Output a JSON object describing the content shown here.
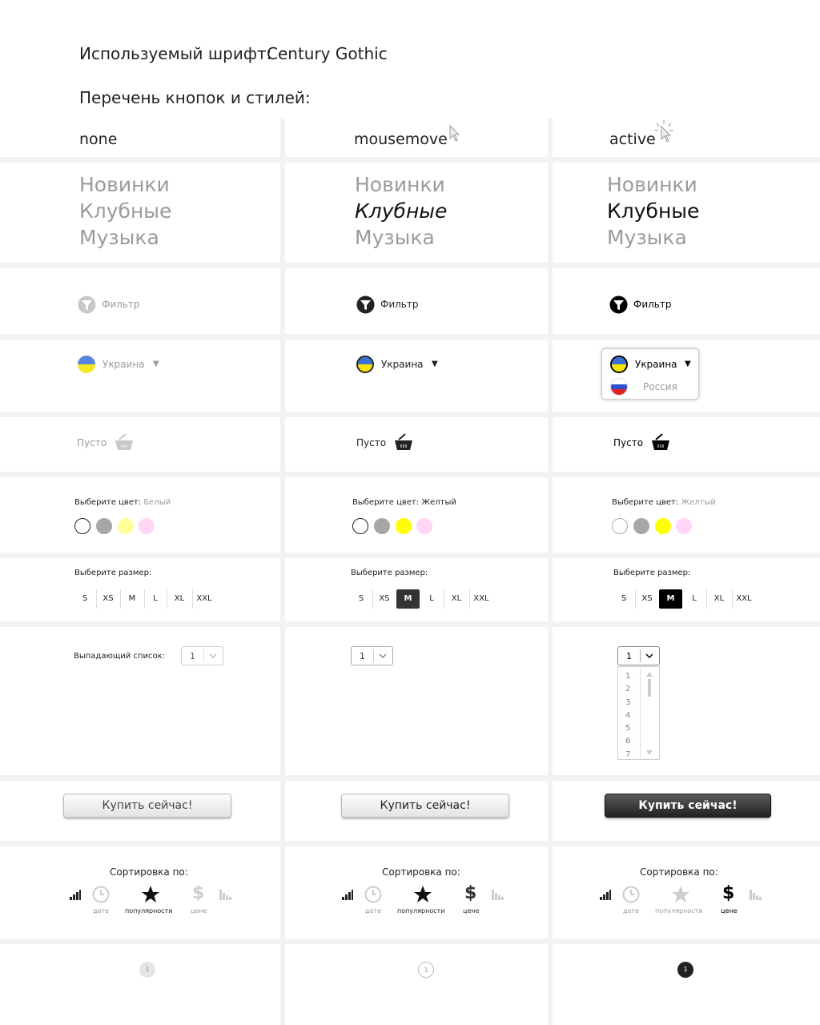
{
  "header": {
    "font_label": "Используемый шрифт:",
    "font_value": "Century Gothic",
    "list_label": "Перечень кнопок и стилей:"
  },
  "columns": [
    {
      "state": "none"
    },
    {
      "state": "mousemove"
    },
    {
      "state": "active"
    }
  ],
  "categories": [
    "Новинки",
    "Клубные",
    "Музыка"
  ],
  "filter_label": "Фильтр",
  "country": {
    "selected": "Украина",
    "options": [
      "Украина",
      "Россия"
    ],
    "arrow": "▼"
  },
  "cart_label": "Пусто",
  "color_picker": {
    "label": "Выберите цвет:",
    "values": [
      "Белый",
      "Желтый",
      "Желтый"
    ],
    "swatches": [
      "#ffffff",
      "#a6a6a6",
      "#ffff99",
      "#ffd6f7"
    ],
    "active_swatches": [
      "#ffffff",
      "#a6a6a6",
      "#ffff00",
      "#ffd6f7"
    ]
  },
  "size_picker": {
    "label": "Выберите размер:",
    "sizes": [
      "S",
      "XS",
      "M",
      "L",
      "XL",
      "XXL"
    ],
    "selected": "M"
  },
  "dropdown": {
    "label": "Выпадающий список:",
    "value": "1",
    "options": [
      "1",
      "2",
      "3",
      "4",
      "5",
      "6",
      "7"
    ]
  },
  "buy_button": "Купить сейчас!",
  "sort": {
    "label": "Сортировка по:",
    "date": "дате",
    "popularity": "популярности",
    "price": "цене"
  },
  "pagination": {
    "page": "1"
  },
  "colors": {
    "gray_text": "#9b9b9b",
    "dark": "#111111",
    "yellow": "#ffff00",
    "ua_blue": "#3a6fd6",
    "ua_yellow": "#f5e300"
  }
}
